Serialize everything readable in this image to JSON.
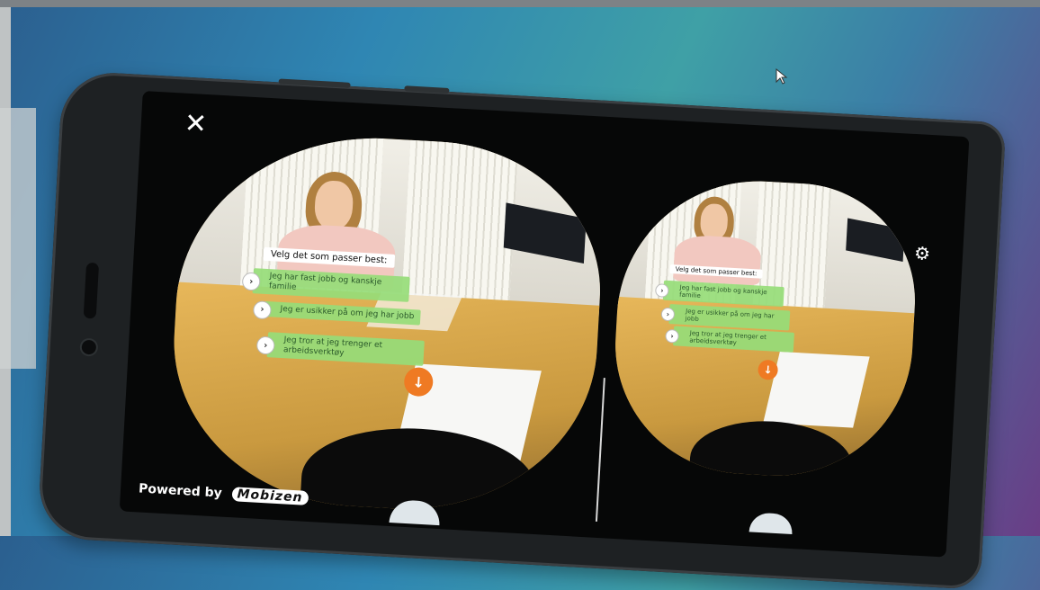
{
  "app": {
    "prompt": "Velg det som passer best:",
    "options": [
      "Jeg har fast jobb og kanskje familie",
      "Jeg er usikker på om jeg har jobb",
      "Jeg tror at jeg trenger et arbeidsverktøy"
    ],
    "powered_by": "Powered by",
    "brand": "Mobizen",
    "icons": {
      "close": "close-icon",
      "settings": "gear-icon",
      "option": "chevron-right-icon",
      "mic": "mic-icon"
    }
  },
  "colors": {
    "option_bg": "#96dc78",
    "mic": "#ef7a23",
    "accent_bg": "#2f86b3"
  }
}
